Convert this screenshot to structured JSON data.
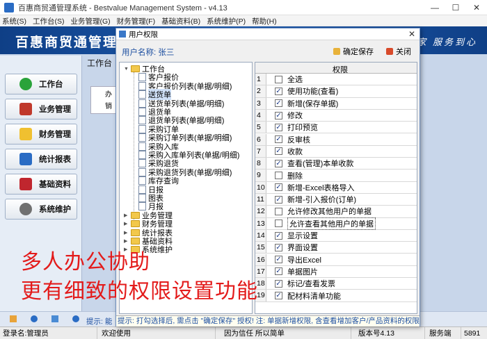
{
  "window": {
    "title": "百惠商贸通管理系统 - Bestvalue Management System - v4.13",
    "minimize": "—",
    "maximize": "☐",
    "close": "✕"
  },
  "menu": [
    "系统(S)",
    "工作台(S)",
    "业务管理(G)",
    "财务管理(F)",
    "基础资料(B)",
    "系统维护(P)",
    "帮助(H)"
  ],
  "banner": {
    "brand": "百惠商贸通管理系",
    "slogan": "家 服务到心"
  },
  "sidebar": {
    "items": [
      {
        "label": "工作台",
        "icon": "check-icon",
        "color": "#2aa33a"
      },
      {
        "label": "业务管理",
        "icon": "house-icon",
        "color": "#c0392b"
      },
      {
        "label": "财务管理",
        "icon": "folder-icon",
        "color": "#f0c030"
      },
      {
        "label": "统计报表",
        "icon": "chart-icon",
        "color": "#2a6cc4"
      },
      {
        "label": "基础资料",
        "icon": "book-icon",
        "color": "#c0262e"
      },
      {
        "label": "系统维护",
        "icon": "gear-icon",
        "color": "#707070"
      }
    ]
  },
  "work_tab": "工作台",
  "background_tree": [
    "办",
    "销"
  ],
  "dialog": {
    "title": "用户权限",
    "user_label": "用户名称: 张三",
    "save_label": "确定保存",
    "close_label": "关闭",
    "tree": [
      {
        "label": "工作台",
        "kind": "folder",
        "expand": "▼"
      },
      {
        "label": "客户报价",
        "kind": "doc"
      },
      {
        "label": "客户报价列表(单据/明细)",
        "kind": "doc"
      },
      {
        "label": "送货单",
        "kind": "doc",
        "selected": true
      },
      {
        "label": "送货单列表(单据/明细)",
        "kind": "doc"
      },
      {
        "label": "退货单",
        "kind": "doc"
      },
      {
        "label": "退货单列表(单据/明细)",
        "kind": "doc"
      },
      {
        "label": "采购订单",
        "kind": "doc"
      },
      {
        "label": "采购订单列表(单据/明细)",
        "kind": "doc"
      },
      {
        "label": "采购入库",
        "kind": "doc"
      },
      {
        "label": "采购入库单列表(单据/明细)",
        "kind": "doc"
      },
      {
        "label": "采购退货",
        "kind": "doc"
      },
      {
        "label": "采购退货列表(单据/明细)",
        "kind": "doc"
      },
      {
        "label": "库存查询",
        "kind": "doc"
      },
      {
        "label": "日报",
        "kind": "doc"
      },
      {
        "label": "图表",
        "kind": "doc"
      },
      {
        "label": "月报",
        "kind": "doc"
      },
      {
        "label": "业务管理",
        "kind": "folder",
        "expand": "▶"
      },
      {
        "label": "财务管理",
        "kind": "folder",
        "expand": "▶"
      },
      {
        "label": "统计报表",
        "kind": "folder",
        "expand": "▶"
      },
      {
        "label": "基础资料",
        "kind": "folder",
        "expand": "▶"
      },
      {
        "label": "系统维护",
        "kind": "folder",
        "expand": "▶"
      }
    ],
    "grid_header": "权限",
    "permissions": [
      {
        "n": "1",
        "label": "全选",
        "checked": false
      },
      {
        "n": "2",
        "label": "使用功能(查看)",
        "checked": true
      },
      {
        "n": "3",
        "label": "新增(保存单据)",
        "checked": true
      },
      {
        "n": "4",
        "label": "修改",
        "checked": true
      },
      {
        "n": "5",
        "label": "打印预览",
        "checked": true
      },
      {
        "n": "6",
        "label": "反审核",
        "checked": true
      },
      {
        "n": "7",
        "label": "收款",
        "checked": true
      },
      {
        "n": "8",
        "label": "查看(管理)本单收款",
        "checked": true
      },
      {
        "n": "9",
        "label": "删除",
        "checked": false
      },
      {
        "n": "10",
        "label": "新增-Excel表格导入",
        "checked": true
      },
      {
        "n": "11",
        "label": "新增-引入报价(订单)",
        "checked": true
      },
      {
        "n": "12",
        "label": "允许修改其他用户的单据",
        "checked": false
      },
      {
        "n": "13",
        "label": "允许查看其他用户的单据",
        "checked": false,
        "selected": true
      },
      {
        "n": "14",
        "label": "显示设置",
        "checked": true
      },
      {
        "n": "15",
        "label": "界面设置",
        "checked": true
      },
      {
        "n": "16",
        "label": "导出Excel",
        "checked": true
      },
      {
        "n": "17",
        "label": "单据图片",
        "checked": true
      },
      {
        "n": "18",
        "label": "标记/查看发票",
        "checked": true
      },
      {
        "n": "19",
        "label": "配材料清单功能",
        "checked": true
      }
    ],
    "hint": "提示: 打勾选择后, 需点击 \"确定保存\" 授权! 注: 单据新增权限, 含查看增加客户/产品资料的权限。"
  },
  "outer_hint": "提示: 能",
  "status": {
    "user": "登录名:管理员",
    "welcome": "欢迎使用",
    "trust": "因为信任 所以简单",
    "version": "版本号4.13",
    "server_label": "服务端",
    "server_port": "5891"
  },
  "overlay": {
    "line1": "多人办公协助",
    "line2": "更有细致的权限设置功能"
  }
}
